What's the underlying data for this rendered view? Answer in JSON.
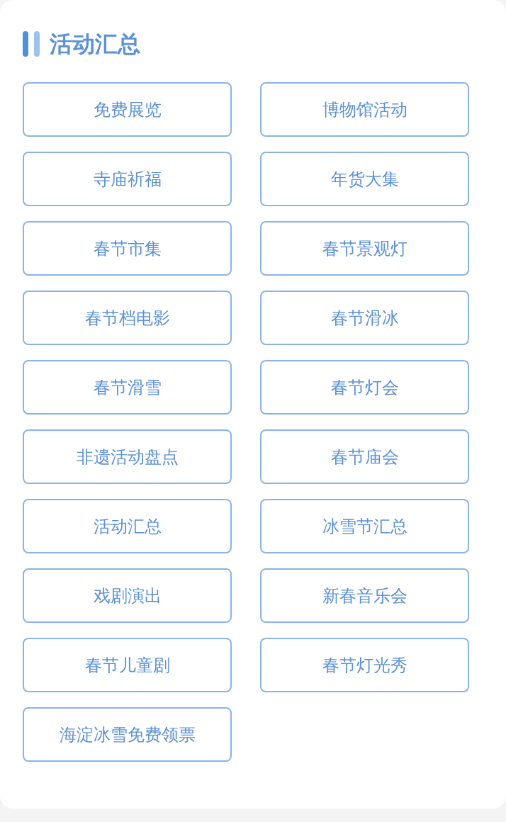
{
  "section": {
    "title": "活动汇总"
  },
  "buttons": [
    "免费展览",
    "博物馆活动",
    "寺庙祈福",
    "年货大集",
    "春节市集",
    "春节景观灯",
    "春节档电影",
    "春节滑冰",
    "春节滑雪",
    "春节灯会",
    "非遗活动盘点",
    "春节庙会",
    "活动汇总",
    "冰雪节汇总",
    "戏剧演出",
    "新春音乐会",
    "春节儿童剧",
    "春节灯光秀",
    "海淀冰雪免费领票"
  ]
}
